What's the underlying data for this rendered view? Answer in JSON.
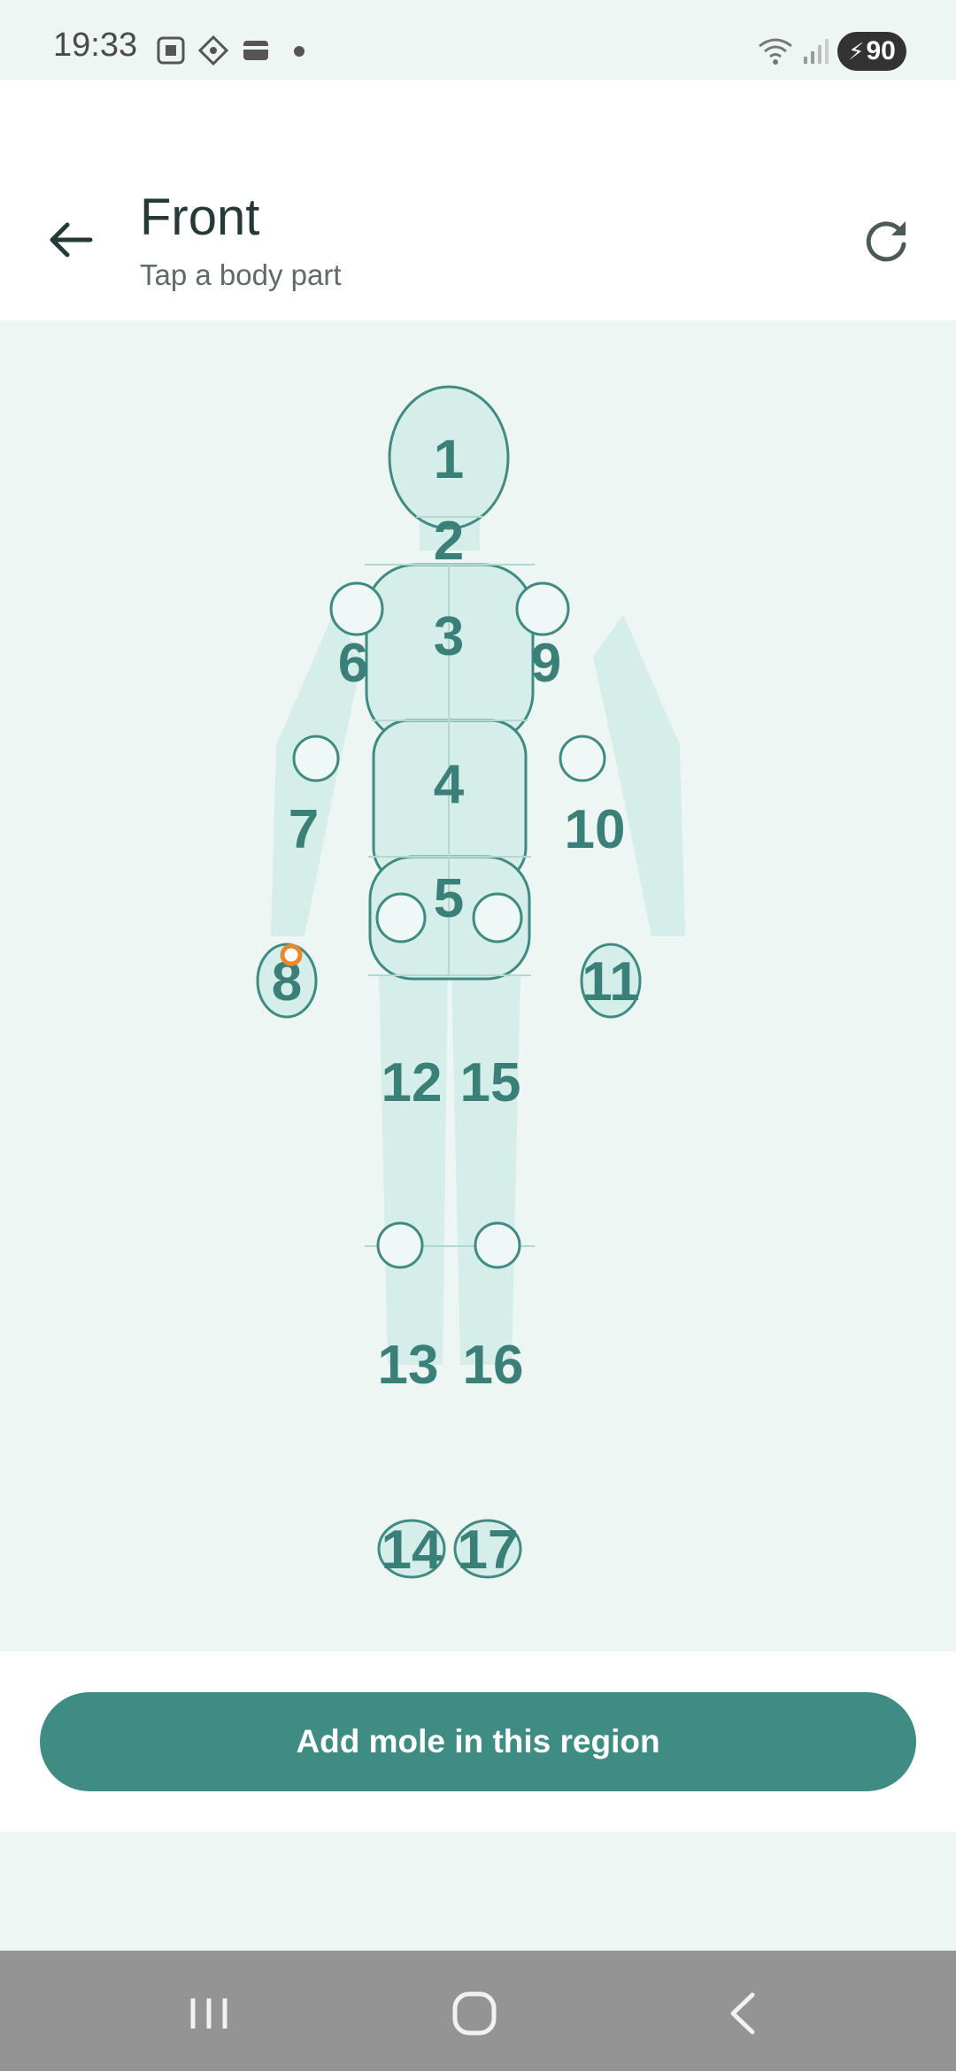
{
  "status_bar": {
    "time": "19:33",
    "battery": "90",
    "icons": [
      "screenshot-icon",
      "diamond-app-icon",
      "wallet-icon",
      "dot-icon",
      "wifi-icon",
      "signal-icon",
      "battery-charging-icon"
    ]
  },
  "header": {
    "title": "Front",
    "subtitle": "Tap a body part",
    "back_icon": "arrow-left-icon",
    "refresh_icon": "refresh-icon"
  },
  "body_map": {
    "regions": [
      {
        "id": "1",
        "label": "1"
      },
      {
        "id": "2",
        "label": "2"
      },
      {
        "id": "3",
        "label": "3"
      },
      {
        "id": "4",
        "label": "4"
      },
      {
        "id": "5",
        "label": "5"
      },
      {
        "id": "6",
        "label": "6"
      },
      {
        "id": "7",
        "label": "7"
      },
      {
        "id": "8",
        "label": "8"
      },
      {
        "id": "9",
        "label": "9"
      },
      {
        "id": "10",
        "label": "10"
      },
      {
        "id": "11",
        "label": "11"
      },
      {
        "id": "12",
        "label": "12"
      },
      {
        "id": "13",
        "label": "13"
      },
      {
        "id": "14",
        "label": "14"
      },
      {
        "id": "15",
        "label": "15"
      },
      {
        "id": "16",
        "label": "16"
      },
      {
        "id": "17",
        "label": "17"
      }
    ],
    "marker_color": "#e8892b",
    "fill_color": "#d6eeea",
    "stroke_color": "#3f8a81"
  },
  "actions": {
    "add_mole_label": "Add mole in this region"
  },
  "nav_bar": {
    "icons": [
      "recents-icon",
      "home-icon",
      "back-nav-icon"
    ]
  },
  "colors": {
    "accent": "#3e8c83",
    "text_primary": "#253a37",
    "text_secondary": "#5f6b69"
  }
}
